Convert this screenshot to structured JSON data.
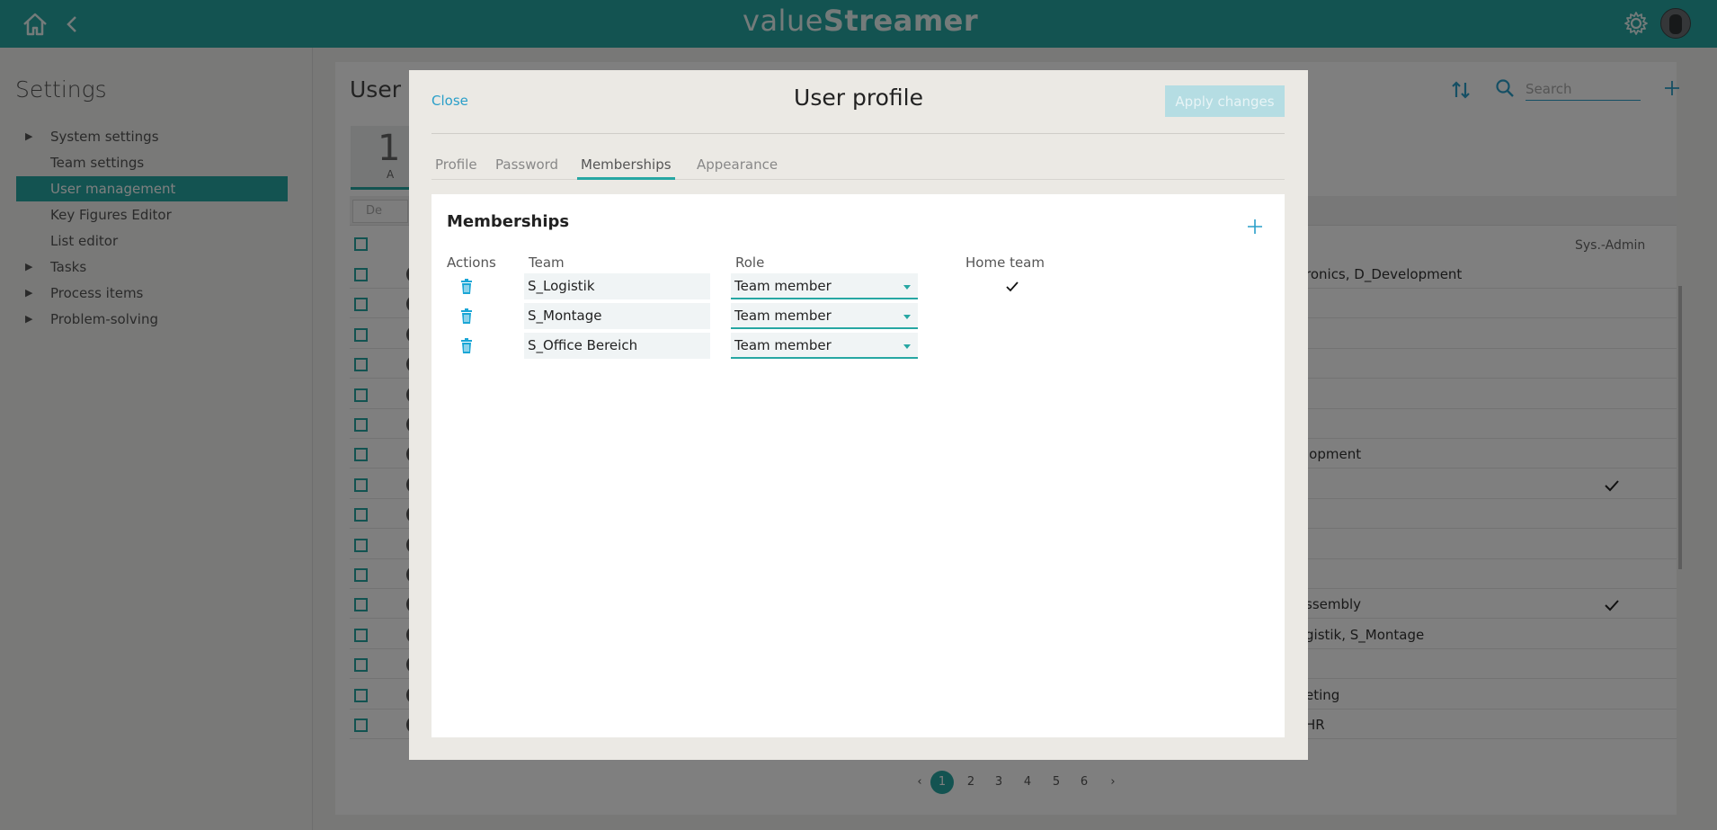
{
  "app": {
    "logo_light": "value",
    "logo_bold": "Streamer"
  },
  "sidebar": {
    "title": "Settings",
    "items": [
      {
        "label": "System settings",
        "expandable": true
      },
      {
        "label": "Team settings",
        "expandable": false
      },
      {
        "label": "User management",
        "expandable": false,
        "active": true
      },
      {
        "label": "Key Figures Editor",
        "expandable": false
      },
      {
        "label": "List editor",
        "expandable": false
      },
      {
        "label": "Tasks",
        "expandable": true
      },
      {
        "label": "Process items",
        "expandable": true
      },
      {
        "label": "Problem-solving",
        "expandable": true
      }
    ]
  },
  "main": {
    "title": "User m",
    "stat_number": "1",
    "stat_label": "A",
    "filter_label": "De",
    "search_placeholder": "Search",
    "sysadmin_col": "Sys.-Admin",
    "rows": [
      {
        "team": "ronics, D_Development",
        "sysadmin": false
      },
      {
        "team": "",
        "sysadmin": false
      },
      {
        "team": "",
        "sysadmin": false
      },
      {
        "team": "",
        "sysadmin": false
      },
      {
        "team": "",
        "sysadmin": false
      },
      {
        "team": "",
        "sysadmin": false
      },
      {
        "team": "lopment",
        "sysadmin": false
      },
      {
        "team": "",
        "sysadmin": true
      },
      {
        "team": "",
        "sysadmin": false
      },
      {
        "team": "",
        "sysadmin": false
      },
      {
        "team": "",
        "sysadmin": false
      },
      {
        "team": "ssembly",
        "sysadmin": true
      },
      {
        "team": "gistik, S_Montage",
        "sysadmin": false
      },
      {
        "team": "",
        "sysadmin": false
      },
      {
        "team": "eting",
        "sysadmin": false
      },
      {
        "team": "HR",
        "sysadmin": false
      }
    ],
    "pagination": {
      "prev": "‹",
      "pages": [
        "1",
        "2",
        "3",
        "4",
        "5",
        "6"
      ],
      "current": "1",
      "next": "›"
    }
  },
  "dialog": {
    "close_label": "Close",
    "title": "User profile",
    "apply_label": "Apply changes",
    "tabs": [
      {
        "label": "Profile"
      },
      {
        "label": "Password"
      },
      {
        "label": "Memberships",
        "active": true
      },
      {
        "label": "Appearance"
      }
    ],
    "memberships": {
      "title": "Memberships",
      "columns": {
        "actions": "Actions",
        "team": "Team",
        "role": "Role",
        "home_team": "Home team"
      },
      "rows": [
        {
          "team": "S_Logistik",
          "role": "Team member",
          "home_team": true
        },
        {
          "team": "S_Montage",
          "role": "Team member",
          "home_team": false
        },
        {
          "team": "S_Office Bereich",
          "role": "Team member",
          "home_team": false
        }
      ]
    }
  },
  "colors": {
    "accent": "#27a7a3",
    "link": "#2a9fc9",
    "apply_disabled": "#b5dde3"
  }
}
